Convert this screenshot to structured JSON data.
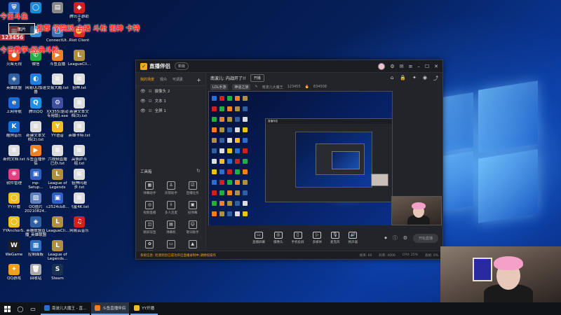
{
  "colors": {
    "accent": "#f5a623",
    "overlay_red": "#ff2020",
    "window_bg": "#232429",
    "taskbar_bg": "#101418"
  },
  "overlay": {
    "line1": "今日斗鱼",
    "line2": "推荐 学院派 主播 斗枪 狙神 卡特",
    "line3": "123456",
    "line4": "今日教学:经典斗枪",
    "rec_label": "图片"
  },
  "desktop_icons": [
    {
      "label": "",
      "color": "#2a6fd0",
      "symbol": "⛨"
    },
    {
      "label": "",
      "color": "#1a8ae0",
      "symbol": "◯"
    },
    {
      "label": "",
      "color": "#888888",
      "symbol": "▤"
    },
    {
      "label": "腾讯手游助手",
      "color": "#d02020",
      "symbol": "◆"
    },
    {
      "label": "",
      "color": "#c04040",
      "symbol": "▦"
    },
    {
      "label": "",
      "color": "#3a8ad0",
      "symbol": "▣"
    },
    {
      "label": "ConnectUt...",
      "color": "#4070b0",
      "symbol": "▢"
    },
    {
      "label": "Riot Client",
      "color": "#d03030",
      "symbol": "✊"
    },
    {
      "label": "火柴无视",
      "color": "#e05020",
      "symbol": "●"
    },
    {
      "label": "微信",
      "color": "#20b040",
      "symbol": "✆"
    },
    {
      "label": "斗鱼直播",
      "color": "#f08020",
      "symbol": "▶"
    },
    {
      "label": "LeagueCli...",
      "color": "#b09040",
      "symbol": "L"
    },
    {
      "label": "英雄联盟",
      "color": "#3060a0",
      "symbol": "◈"
    },
    {
      "label": "网易UU加速器",
      "color": "#2080e0",
      "symbol": "◐"
    },
    {
      "label": "交易大概.txt",
      "color": "#dddddd",
      "symbol": "≡"
    },
    {
      "label": "狙神.txt",
      "color": "#dddddd",
      "symbol": "≡"
    },
    {
      "label": "上网导航",
      "color": "#1a6ad0",
      "symbol": "e"
    },
    {
      "label": "腾讯QQ",
      "color": "#2090e0",
      "symbol": "Q"
    },
    {
      "label": "XX355(驱动专用版).exe",
      "color": "#4050a0",
      "symbol": "⚙"
    },
    {
      "label": "新建文本文档(3).txt",
      "color": "#dddddd",
      "symbol": "≡"
    },
    {
      "label": "酷狗音乐",
      "color": "#1a70d0",
      "symbol": "K"
    },
    {
      "label": "新建文本文档(2).txt",
      "color": "#dddddd",
      "symbol": "≡"
    },
    {
      "label": "YY语音",
      "color": "#f0c020",
      "symbol": "Y"
    },
    {
      "label": "英雄卡特.txt",
      "color": "#dddddd",
      "symbol": "≡"
    },
    {
      "label": "新的文档.txt",
      "color": "#dddddd",
      "symbol": "≡"
    },
    {
      "label": "斗鱼直播伴侣",
      "color": "#f08020",
      "symbol": "▶"
    },
    {
      "label": "六视频直播已办.txt",
      "color": "#dddddd",
      "symbol": "≡"
    },
    {
      "label": "高佩萨斗组.txt",
      "color": "#dddddd",
      "symbol": "≡"
    },
    {
      "label": "软件管理",
      "color": "#e04080",
      "symbol": "❋"
    },
    {
      "label": "mp-Setup...",
      "color": "#3060c0",
      "symbol": "▣"
    },
    {
      "label": "League of Legends",
      "color": "#b09040",
      "symbol": "L"
    },
    {
      "label": "狙神闪避步.txt",
      "color": "#dddddd",
      "symbol": "≡"
    },
    {
      "label": "YY开播",
      "color": "#f0c020",
      "symbol": "◯"
    },
    {
      "label": "QQ图片20210824...",
      "color": "#6080c0",
      "symbol": "▨"
    },
    {
      "label": "c2524cb8...",
      "color": "#3060c0",
      "symbol": "▣"
    },
    {
      "label": "飞星4K.txt",
      "color": "#dddddd",
      "symbol": "≡"
    },
    {
      "label": "YYAnchorS...",
      "color": "#f0c020",
      "symbol": "◯"
    },
    {
      "label": "英雄联盟直播_英雄联盟",
      "color": "#3060a0",
      "symbol": "◈"
    },
    {
      "label": "LeagueCli...",
      "color": "#b09040",
      "symbol": "L"
    },
    {
      "label": "网易云音乐",
      "color": "#d02020",
      "symbol": "♫"
    },
    {
      "label": "WeGame",
      "color": "#202020",
      "symbol": "W"
    },
    {
      "label": "控制面板",
      "color": "#3070c0",
      "symbol": "▦"
    },
    {
      "label": "League of Legends...",
      "color": "#b09040",
      "symbol": "L"
    },
    {
      "label": "",
      "color": "#000000",
      "symbol": ""
    },
    {
      "label": "QQ游戏",
      "color": "#f0a020",
      "symbol": "✦"
    },
    {
      "label": "回收站",
      "color": "#aaaaaa",
      "symbol": "🗑"
    },
    {
      "label": "Steam",
      "color": "#1a3050",
      "symbol": "S"
    }
  ],
  "app": {
    "brand": "直播伴侣",
    "version": "新版",
    "sidebar_tabs": [
      "我的场景",
      "观众",
      "可调素"
    ],
    "scenes": [
      "摄像头 2",
      "文本 1",
      "全屏 1"
    ],
    "tools_heading": "工具箱",
    "tools": [
      "弹幕助手",
      "房管助手",
      "直播任务",
      "视频直播",
      "多人连麦",
      "投弹幕",
      "跳屏双直",
      "弹幕机",
      "歌词助手",
      "虚拟",
      "",
      ""
    ],
    "room_title": "南波儿: 内战开了!!",
    "room_btn": "开播",
    "info_chips": [
      "LOL手游",
      "神话之旅"
    ],
    "info_text": "南波儿大魔王",
    "room_id": "123455",
    "fans": "834508",
    "bottom_actions": [
      "直播屏幕",
      "摄像头",
      "手机投屏",
      "多媒体",
      "麦克风",
      "扬声器"
    ],
    "go_live": "开始直播",
    "status_warn": "系统信息: 检测到您已成功开启直播录制中,请继续操作",
    "stats": [
      "帧率: 60",
      "码率: 4000",
      "CPU: 25%",
      "丢帧: 0%"
    ]
  },
  "taskbar": {
    "tasks": [
      {
        "label": "南波儿大魔王 - 直...",
        "color": "#2a6fd0",
        "active": false
      },
      {
        "label": "斗鱼直播伴侣",
        "color": "#f08020",
        "active": true
      },
      {
        "label": "YY开播",
        "color": "#f0c020",
        "active": false
      }
    ]
  }
}
